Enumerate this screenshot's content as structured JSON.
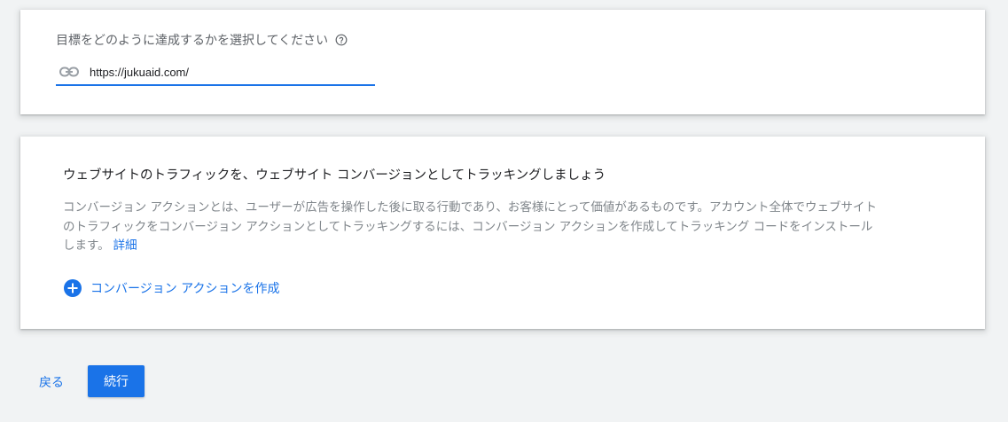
{
  "goal_card": {
    "label": "目標をどのように達成するかを選択してください",
    "help_icon": "help-circle-icon",
    "link_icon": "link-icon",
    "url_value": "https://jukuaid.com/"
  },
  "tracking_card": {
    "title": "ウェブサイトのトラフィックを、ウェブサイト コンバージョンとしてトラッキングしましょう",
    "description": "コンバージョン アクションとは、ユーザーが広告を操作した後に取る行動であり、お客様にとって価値があるものです。アカウント全体でウェブサイトのトラフィックをコンバージョン アクションとしてトラッキングするには、コンバージョン アクションを作成してトラッキング コードをインストールします。",
    "details_link": "詳細",
    "create_action_icon": "add-circle-icon",
    "create_action_label": "コンバージョン アクションを作成"
  },
  "footer": {
    "back_label": "戻る",
    "continue_label": "続行"
  },
  "colors": {
    "accent": "#1a73e8",
    "background": "#f1f3f4",
    "card": "#ffffff",
    "text_primary": "#202124",
    "text_secondary": "#5f6368"
  }
}
